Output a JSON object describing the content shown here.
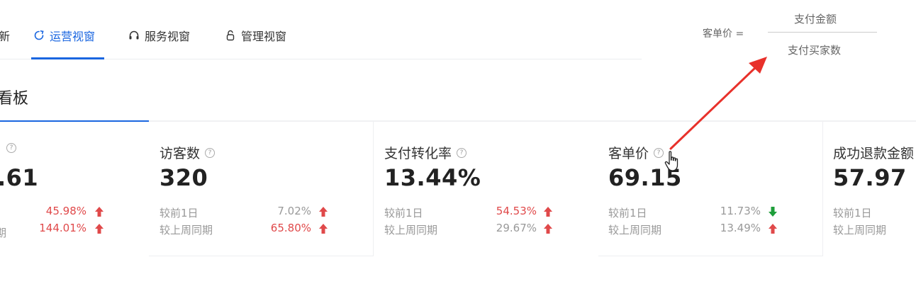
{
  "tabs": [
    {
      "label": "新",
      "active": false,
      "icon": ""
    },
    {
      "label": "运营视窗",
      "active": true,
      "icon": "refresh-circle-icon"
    },
    {
      "label": "服务视窗",
      "active": false,
      "icon": "headset-icon"
    },
    {
      "label": "管理视窗",
      "active": false,
      "icon": "lock-icon"
    }
  ],
  "board_title": "看板",
  "cards": [
    {
      "name": "",
      "value": ".61",
      "cmp_day_label": "",
      "cmp_day_pct": "45.98%",
      "cmp_day_dir": "up",
      "cmp_week_label": "期",
      "cmp_week_pct": "144.01%",
      "cmp_week_dir": "up"
    },
    {
      "name": "访客数",
      "value": "320",
      "cmp_day_label": "较前1日",
      "cmp_day_pct": "7.02%",
      "cmp_day_dir": "up",
      "cmp_week_label": "较上周同期",
      "cmp_week_pct": "65.80%",
      "cmp_week_dir": "up"
    },
    {
      "name": "支付转化率",
      "value": "13.44%",
      "cmp_day_label": "较前1日",
      "cmp_day_pct": "54.53%",
      "cmp_day_dir": "up",
      "cmp_week_label": "较上周同期",
      "cmp_week_pct": "29.67%",
      "cmp_week_dir": "up"
    },
    {
      "name": "客单价",
      "value": "69.15",
      "cmp_day_label": "较前1日",
      "cmp_day_pct": "11.73%",
      "cmp_day_dir": "down",
      "cmp_week_label": "较上周同期",
      "cmp_week_pct": "13.49%",
      "cmp_week_dir": "up"
    },
    {
      "name": "成功退款金额",
      "value": "57.97",
      "cmp_day_label": "较前1日",
      "cmp_day_pct": "",
      "cmp_day_dir": "",
      "cmp_week_label": "较上周同期",
      "cmp_week_pct": "",
      "cmp_week_dir": ""
    }
  ],
  "formula": {
    "lhs": "客单价 =",
    "numerator": "支付金额",
    "denominator": "支付买家数"
  },
  "colors": {
    "accent": "#1a66e0",
    "up": "#e0494a",
    "down": "#1e9e3a",
    "annotation_arrow": "#e8312b"
  }
}
